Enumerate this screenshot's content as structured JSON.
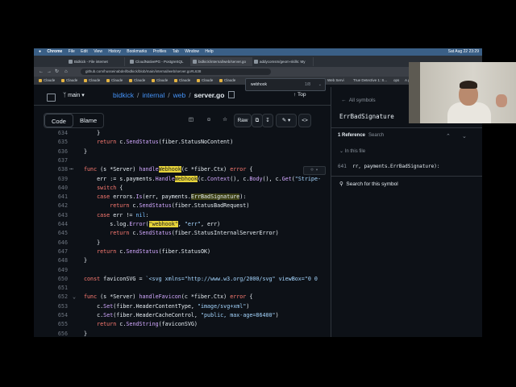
{
  "browser": {
    "menubar": {
      "items": [
        "Chrome",
        "File",
        "Edit",
        "View",
        "History",
        "Bookmarks",
        "Profiles",
        "Tab",
        "Window",
        "Help"
      ],
      "clock": "Sat Aug 22 23:29"
    },
    "tabs": [
      {
        "label": "Bidkick - File internet"
      },
      {
        "label": "CloudNativePG - PostgreSQL"
      },
      {
        "label": "bidkick/internal/web/server.go"
      },
      {
        "label": "addycomsm/geom-skills: My"
      }
    ],
    "url": "github.com/husseinabdel/bidkick/blob/main/internal/web/server.go#L638",
    "bookmarks": [
      "Claude",
      "Claude",
      "Claude",
      "Claude",
      "Claude",
      "Claude",
      "Claude",
      "Claude",
      "Claude",
      "Comm",
      "Web Servi",
      "True Detective 1: S...",
      "ops",
      "A geom"
    ],
    "find": {
      "query": "webhook",
      "count": "1/8"
    }
  },
  "github": {
    "branch": "main",
    "breadcrumb": [
      "bidkick",
      "internal",
      "web"
    ],
    "file": "server.go",
    "top_label": "Top",
    "view_tabs": [
      "Code",
      "Blame"
    ],
    "raw_label": "Raw"
  },
  "code": {
    "lines": [
      {
        "n": "634",
        "t": "    }"
      },
      {
        "n": "635",
        "t": "    return c.SendStatus(fiber.StatusNoContent)"
      },
      {
        "n": "636",
        "t": "}"
      },
      {
        "n": "637",
        "t": ""
      },
      {
        "n": "638",
        "t": "func (s *Server) handleWebhook(c *fiber.Ctx) error {"
      },
      {
        "n": "639",
        "t": "    err := s.payments.HandleWebhook(c.Context(), c.Body(), c.Get(\"Stripe-"
      },
      {
        "n": "640",
        "t": "    switch {"
      },
      {
        "n": "641",
        "t": "    case errors.Is(err, payments.ErrBadSignature):"
      },
      {
        "n": "642",
        "t": "        return c.SendStatus(fiber.StatusBadRequest)"
      },
      {
        "n": "643",
        "t": "    case err != nil:"
      },
      {
        "n": "644",
        "t": "        s.log.Error(\"webhook\", \"err\", err)"
      },
      {
        "n": "645",
        "t": "        return c.SendStatus(fiber.StatusInternalServerError)"
      },
      {
        "n": "646",
        "t": "    }"
      },
      {
        "n": "647",
        "t": "    return c.SendStatus(fiber.StatusOK)"
      },
      {
        "n": "648",
        "t": "}"
      },
      {
        "n": "649",
        "t": ""
      },
      {
        "n": "650",
        "t": "const faviconSVG = `<svg xmlns=\"http://www.w3.org/2000/svg\" viewBox=\"0 0"
      },
      {
        "n": "651",
        "t": ""
      },
      {
        "n": "652",
        "t": "func (s *Server) handleFavicon(c *fiber.Ctx) error {"
      },
      {
        "n": "653",
        "t": "    c.Set(fiber.HeaderContentType, \"image/svg+xml\")"
      },
      {
        "n": "654",
        "t": "    c.Set(fiber.HeaderCacheControl, \"public, max-age=86400\")"
      },
      {
        "n": "655",
        "t": "    return c.SendString(faviconSVG)"
      },
      {
        "n": "656",
        "t": "}"
      }
    ]
  },
  "symbols": {
    "back_label": "All symbols",
    "symbol": "ErrBadSignature",
    "references_label": "1 Reference",
    "search_label": "Search",
    "in_file_label": "In this file",
    "match_line": "641",
    "match_text": "rr, payments.ErrBadSignature):",
    "search_symbol_label": "Search for this symbol"
  }
}
